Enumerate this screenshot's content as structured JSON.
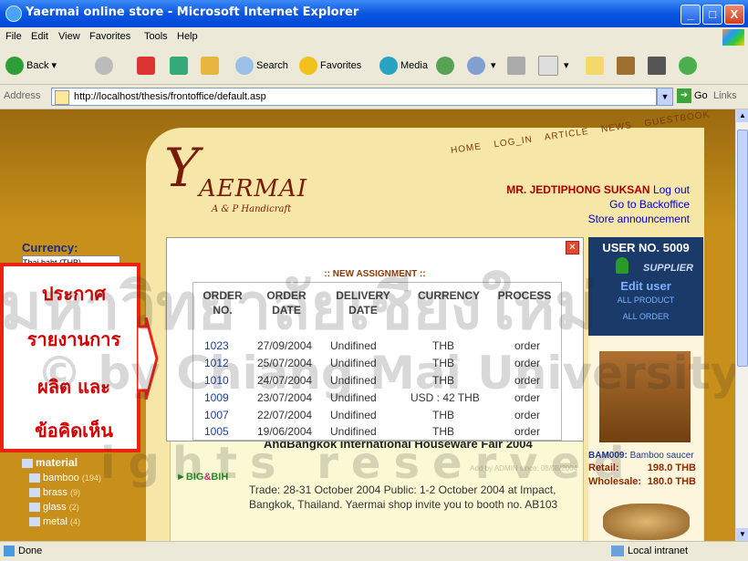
{
  "window": {
    "title": "Yaermai online store - Microsoft Internet Explorer",
    "min": "_",
    "max": "□",
    "close": "X"
  },
  "menu": [
    "File",
    "Edit",
    "View",
    "Favorites",
    "Tools",
    "Help"
  ],
  "toolbar": {
    "back": "Back",
    "search": "Search",
    "favorites": "Favorites",
    "media": "Media"
  },
  "address": {
    "label": "Address",
    "url": "http://localhost/thesis/frontoffice/default.asp",
    "go": "Go",
    "links": "Links"
  },
  "site": {
    "logo_y": "Y",
    "logo_rest": "AERMAI",
    "logo_sub": "A & P Handicraft",
    "nav": [
      "HOME",
      "LOG_IN",
      "ARTICLE",
      "NEWS",
      "GUESTBOOK"
    ],
    "user": "MR. JEDTIPHONG SUKSAN",
    "logout": "Log out",
    "backoffice": "Go to Backoffice",
    "announcement": "Store announcement",
    "currency_label": "Currency:",
    "currency_value": "Thai baht (THB)"
  },
  "popup": {
    "heading": ":: NEW ASSIGNMENT ::",
    "columns": [
      "ORDER NO.",
      "ORDER DATE",
      "DELIVERY DATE",
      "CURRENCY",
      "PROCESS"
    ],
    "rows": [
      {
        "no": "1023",
        "date": "27/09/2004",
        "delivery": "Undifined",
        "currency": "THB",
        "process": "order"
      },
      {
        "no": "1012",
        "date": "25/07/2004",
        "delivery": "Undifined",
        "currency": "THB",
        "process": "order"
      },
      {
        "no": "1010",
        "date": "24/07/2004",
        "delivery": "Undifined",
        "currency": "THB",
        "process": "order"
      },
      {
        "no": "1009",
        "date": "23/07/2004",
        "delivery": "Undifined",
        "currency": "USD : 42 THB",
        "process": "order"
      },
      {
        "no": "1007",
        "date": "22/07/2004",
        "delivery": "Undifined",
        "currency": "THB",
        "process": "order"
      },
      {
        "no": "1005",
        "date": "19/06/2004",
        "delivery": "Undifined",
        "currency": "THB",
        "process": "order"
      }
    ]
  },
  "callout": [
    "ประกาศ",
    "รายงานการ",
    "ผลิต และ",
    "ข้อคิดเห็น"
  ],
  "panel": {
    "user_no": "USER NO. 5009",
    "role": "SUPPLIER",
    "edit": "Edit user",
    "all_product": "ALL PRODUCT",
    "all_order": "ALL ORDER",
    "product_code": "BAM009:",
    "product_name": "Bamboo saucer",
    "retail_label": "Retail:",
    "retail_value": "198.0 THB",
    "wholesale_label": "Wholesale:",
    "wholesale_value": "180.0 THB"
  },
  "news": {
    "title": "AndBangkok International Houseware Fair 2004",
    "added_by": "Add by ADMIN since: 08/08/2004",
    "body": "Trade: 28-31 October 2004 Public: 1-2 October 2004 at Impact, Bangkok, Thailand. Yaermai shop invite you to booth no. AB103",
    "big": "BIG",
    "bih": "BIH"
  },
  "categories": {
    "title": "material",
    "items": [
      {
        "name": "bamboo",
        "count": "(194)"
      },
      {
        "name": "brass",
        "count": "(9)"
      },
      {
        "name": "glass",
        "count": "(2)"
      },
      {
        "name": "metal",
        "count": "(4)"
      }
    ]
  },
  "status": {
    "done": "Done",
    "zone": "Local intranet"
  },
  "watermark": {
    "line1": "มหาวิทยาลัยเชียงใหม่",
    "line2": "© by Chiang Mai University",
    "line3": "ights reserved"
  }
}
